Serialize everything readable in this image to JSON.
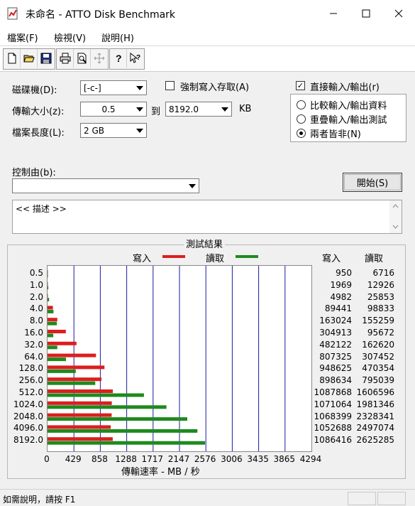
{
  "window": {
    "title": "未命名 - ATTO Disk Benchmark"
  },
  "menu": {
    "items": [
      "檔案(F)",
      "檢視(V)",
      "說明(H)"
    ]
  },
  "form": {
    "drive_label": "磁碟機(D):",
    "drive_value": "[-c-]",
    "transfer_label": "傳輸大小(z):",
    "transfer_from": "0.5",
    "to_label": "到",
    "transfer_to": "8192.0",
    "unit": "KB",
    "length_label": "檔案長度(L):",
    "length_value": "2 GB",
    "force_write_label": "強制寫入存取(A)",
    "direct_io_label": "直接輸入/輸出(r)",
    "direct_io_checked": true,
    "compare_label": "比較輸入/輸出資料",
    "overlap_label": "重疊輸入/輸出測試",
    "neither_label": "兩者皆非(N)",
    "control_label": "控制由(b):",
    "control_value": "",
    "start_button": "開始(S)",
    "description": "<< 描述 >>"
  },
  "results": {
    "title": "測試結果",
    "legend_write": "寫入",
    "legend_read": "讀取",
    "col_write": "寫入",
    "col_read": "讀取",
    "xaxis_title": "傳輸速率 - MB / 秒",
    "write_color": "#dc1e1e",
    "read_color": "#1e8a1e",
    "gridline_color": "#1a1aa0"
  },
  "chart_data": {
    "type": "bar",
    "orientation": "horizontal",
    "xlabel": "傳輸速率 - MB / 秒",
    "xlim": [
      0,
      4294
    ],
    "x_ticks": [
      "0",
      "429",
      "858",
      "1288",
      "1717",
      "2147",
      "2576",
      "3006",
      "3435",
      "3865",
      "4294"
    ],
    "categories": [
      "0.5",
      "1.0",
      "2.0",
      "4.0",
      "8.0",
      "16.0",
      "32.0",
      "64.0",
      "128.0",
      "256.0",
      "512.0",
      "1024.0",
      "2048.0",
      "4096.0",
      "8192.0"
    ],
    "series": [
      {
        "name": "寫入",
        "values_kbs": [
          950,
          1969,
          4982,
          89441,
          163024,
          304913,
          482122,
          807325,
          948625,
          898634,
          1087868,
          1071064,
          1068399,
          1052688,
          1086416
        ]
      },
      {
        "name": "讀取",
        "values_kbs": [
          6716,
          12926,
          25853,
          98833,
          155259,
          95672,
          162620,
          307452,
          470354,
          795039,
          1606596,
          1981346,
          2328341,
          2497074,
          2625285
        ]
      }
    ]
  },
  "status": {
    "text": "如需說明，請按 F1"
  }
}
